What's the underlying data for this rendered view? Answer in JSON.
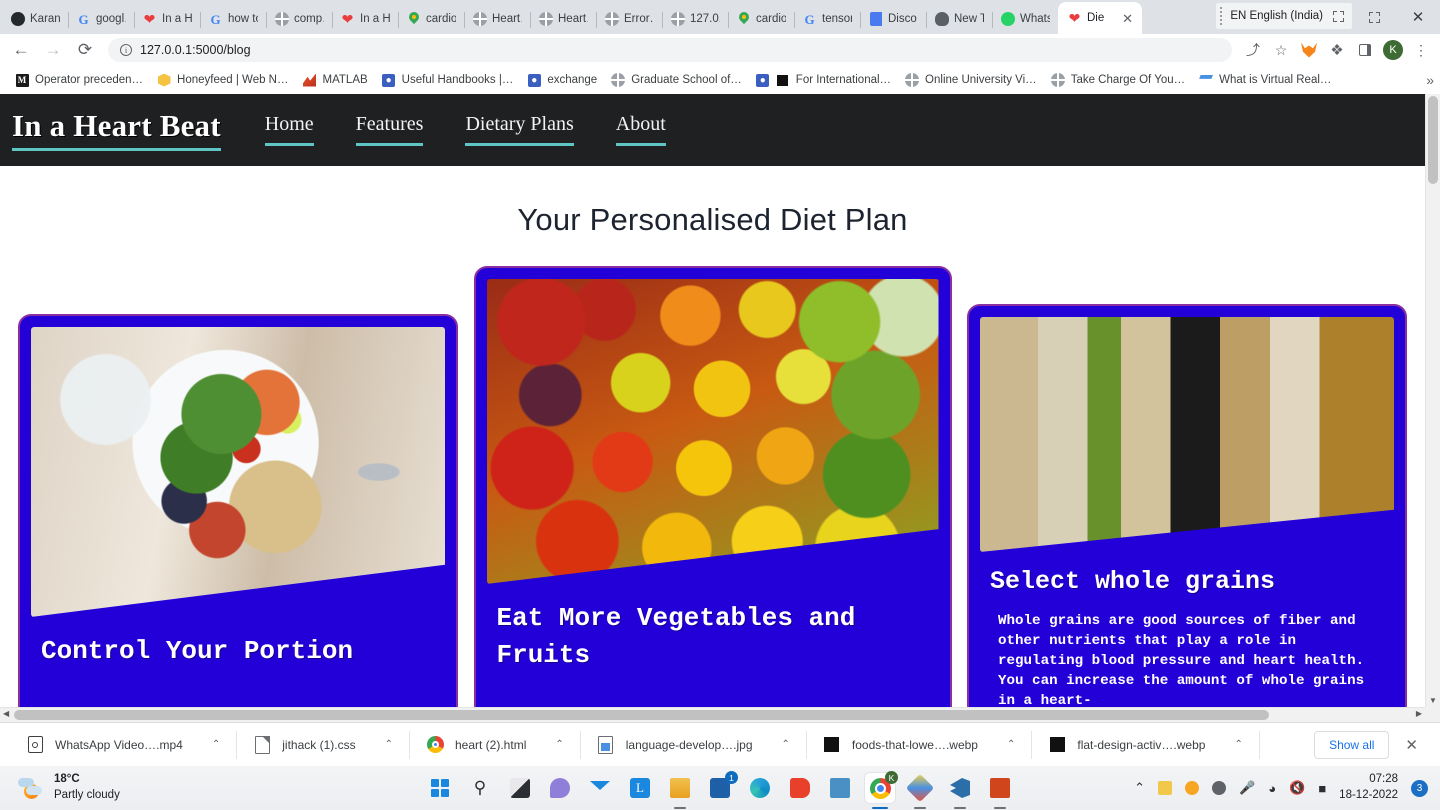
{
  "browser": {
    "tabs": [
      {
        "label": "Karan…",
        "icon": "github-icon"
      },
      {
        "label": "googl…",
        "icon": "google-icon"
      },
      {
        "label": "In a H…",
        "icon": "heart-icon"
      },
      {
        "label": "how to…",
        "icon": "google-icon"
      },
      {
        "label": "comp…",
        "icon": "globe-icon"
      },
      {
        "label": "In a H…",
        "icon": "heart-icon"
      },
      {
        "label": "cardio…",
        "icon": "maps-pin-icon"
      },
      {
        "label": "Heart…",
        "icon": "globe-icon"
      },
      {
        "label": "Heart…",
        "icon": "globe-icon"
      },
      {
        "label": "Error…",
        "icon": "globe-icon"
      },
      {
        "label": "127.0.…",
        "icon": "globe-icon"
      },
      {
        "label": "cardio…",
        "icon": "maps-pin-icon"
      },
      {
        "label": "tensor…",
        "icon": "google-icon"
      },
      {
        "label": "Disco…",
        "icon": "blue-doc-icon"
      },
      {
        "label": "New T…",
        "icon": "ghost-icon"
      },
      {
        "label": "Whats…",
        "icon": "whatsapp-icon"
      }
    ],
    "active_tab": {
      "label": "Die",
      "icon": "heart-icon",
      "close": "✕"
    },
    "language_indicator": "EN English (India)",
    "window_controls": {
      "restore": "❐",
      "close": "✕"
    },
    "nav": {
      "back": "←",
      "forward": "→",
      "reload": "⟳"
    },
    "address": {
      "value": "127.0.0.1:5000/blog",
      "info_glyph": "i"
    },
    "toolbar_icons": [
      {
        "name": "share-icon",
        "glyph": "⤴"
      },
      {
        "name": "bookmark-star-icon",
        "glyph": "☆"
      },
      {
        "name": "metamask-extension-icon",
        "glyph": ""
      },
      {
        "name": "extensions-puzzle-icon",
        "glyph": "❖"
      },
      {
        "name": "side-panel-icon",
        "glyph": ""
      },
      {
        "name": "profile-avatar",
        "glyph": "K"
      },
      {
        "name": "chrome-menu-icon",
        "glyph": "⋮"
      }
    ],
    "bookmarks": [
      {
        "label": "Operator preceden…",
        "icon": "matlab-square-icon"
      },
      {
        "label": "Honeyfeed | Web N…",
        "icon": "honeycomb-icon"
      },
      {
        "label": "MATLAB",
        "icon": "matlab-icon"
      },
      {
        "label": "Useful Handbooks |…",
        "icon": "stackexchange-icon"
      },
      {
        "label": "exchange",
        "icon": "stackexchange-icon"
      },
      {
        "label": "Graduate School of…",
        "icon": "globe-icon"
      },
      {
        "label": "For International…",
        "icon": "black-square-icon"
      },
      {
        "label": "Online University Vi…",
        "icon": "globe-icon"
      },
      {
        "label": "Take Charge Of You…",
        "icon": "globe-icon"
      },
      {
        "label": "What is Virtual Real…",
        "icon": "vr-icon"
      }
    ],
    "bookmarks_overflow": "»"
  },
  "site": {
    "brand": "In a Heart Beat",
    "nav": [
      {
        "label": "Home"
      },
      {
        "label": "Features"
      },
      {
        "label": "Dietary Plans"
      },
      {
        "label": "About"
      }
    ],
    "page_title": "Your Personalised Diet Plan",
    "cards": [
      {
        "title": "Control Your Portion",
        "body": "",
        "image": "healthy-plate-salmon-salad-photo"
      },
      {
        "title": "Eat More Vegetables and Fruits",
        "body": "",
        "image": "assorted-vegetables-fruits-photo"
      },
      {
        "title": "Select whole grains",
        "body": "Whole grains are good sources of fiber and other nutrients that play a role in regulating blood pressure and heart health. You can increase the amount of whole grains in a heart-",
        "image": "assorted-whole-grains-photo"
      }
    ],
    "colors": {
      "header_bg": "#1f2022",
      "accent_underline": "#5fc5c5",
      "card_bg": "#2400d8",
      "card_border": "#8b2fa0",
      "title_text": "#1d2430"
    }
  },
  "downloads": {
    "items": [
      {
        "label": "WhatsApp Video….mp4",
        "icon": "video-file-icon",
        "caret": "⌃"
      },
      {
        "label": "jithack (1).css",
        "icon": "css-file-icon",
        "caret": "⌃"
      },
      {
        "label": "heart (2).html",
        "icon": "chrome-html-icon",
        "caret": "⌃"
      },
      {
        "label": "language-develop….jpg",
        "icon": "jpg-file-icon",
        "caret": "⌃"
      },
      {
        "label": "foods-that-lowe….webp",
        "icon": "webp-file-icon",
        "caret": "⌃"
      },
      {
        "label": "flat-design-activ….webp",
        "icon": "webp-file-icon",
        "caret": "⌃"
      }
    ],
    "show_all": "Show all",
    "close": "✕"
  },
  "taskbar": {
    "weather": {
      "temperature": "18°C",
      "condition": "Partly cloudy",
      "icon": "partly-cloudy-icon"
    },
    "apps": [
      {
        "name": "start-button",
        "icon": "windows-logo-icon"
      },
      {
        "name": "search-button",
        "icon": "search-icon"
      },
      {
        "name": "task-view-button",
        "icon": "task-view-icon"
      },
      {
        "name": "chat-button",
        "icon": "chat-icon"
      },
      {
        "name": "mail-app",
        "icon": "mail-icon"
      },
      {
        "name": "lens-app",
        "icon": "lens-icon"
      },
      {
        "name": "file-explorer",
        "icon": "folder-icon"
      },
      {
        "name": "microsoft-store",
        "icon": "store-icon",
        "badge": "1"
      },
      {
        "name": "microsoft-edge",
        "icon": "edge-icon"
      },
      {
        "name": "office-app",
        "icon": "office-icon"
      },
      {
        "name": "remote-desktop",
        "icon": "monitor-icon"
      },
      {
        "name": "google-chrome",
        "icon": "chrome-icon",
        "active": true
      },
      {
        "name": "paint-app",
        "icon": "paint-icon"
      },
      {
        "name": "visual-studio-code",
        "icon": "vscode-icon"
      },
      {
        "name": "powerpoint-app",
        "icon": "powerpoint-icon"
      }
    ],
    "tray": [
      {
        "name": "show-hidden-icons",
        "glyph": "⌃"
      },
      {
        "name": "antivirus-icon",
        "glyph": ""
      },
      {
        "name": "onedrive-sync-icon",
        "glyph": ""
      },
      {
        "name": "meet-camera-icon",
        "glyph": ""
      },
      {
        "name": "microphone-icon",
        "glyph": ""
      },
      {
        "name": "wifi-icon",
        "glyph": ""
      },
      {
        "name": "volume-muted-icon",
        "glyph": ""
      },
      {
        "name": "battery-icon",
        "glyph": ""
      }
    ],
    "clock": {
      "time": "07:28",
      "date": "18-12-2022"
    },
    "notification_count": "3"
  }
}
